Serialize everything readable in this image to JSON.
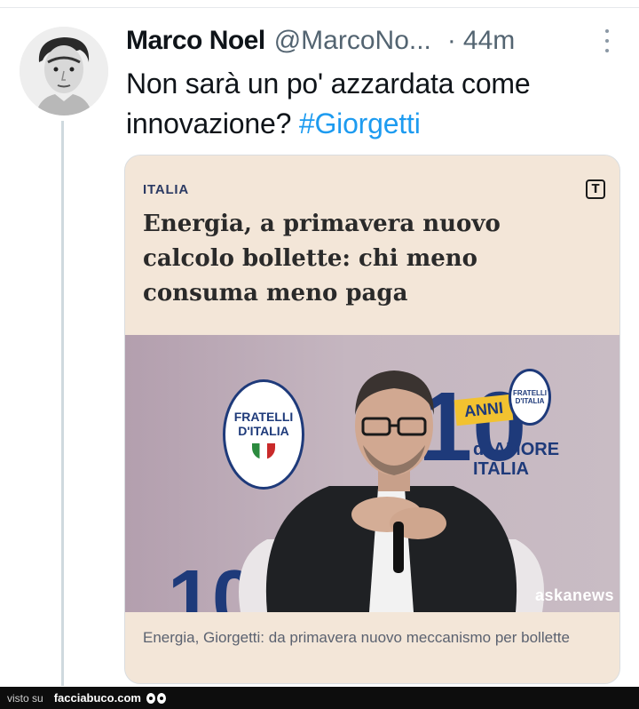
{
  "tweet": {
    "author_name": "Marco Noel",
    "author_handle": "@MarcoNo...",
    "separator": "·",
    "time": "44m",
    "text_before": "Non sarà un po' azzardata come innovazione? ",
    "hashtag": "#Giorgetti"
  },
  "card": {
    "section": "ITALIA",
    "source_icon_letter": "T",
    "headline": "Energia, a primavera nuovo calcolo bollette: chi meno consuma meno paga",
    "caption": "Energia, Giorgetti: da primavera nuovo meccanismo per bollette",
    "photo": {
      "badge_big_text": "FRATELLI D'ITALIA",
      "badge_small_text": "FRATELLI D'ITALIA",
      "digit_1": "10",
      "anni": "ANNI",
      "amore_line1": "di AMORE",
      "amore_line2": "ITALIA",
      "digit_2": "10",
      "watermark": "askanews"
    }
  },
  "footer": {
    "visto_su": "visto su",
    "site": "facciabuco.com"
  },
  "colors": {
    "link": "#1d9bf0",
    "muted": "#536471",
    "card_bg": "#f3e6d8",
    "party_blue": "#1e3a7a"
  }
}
